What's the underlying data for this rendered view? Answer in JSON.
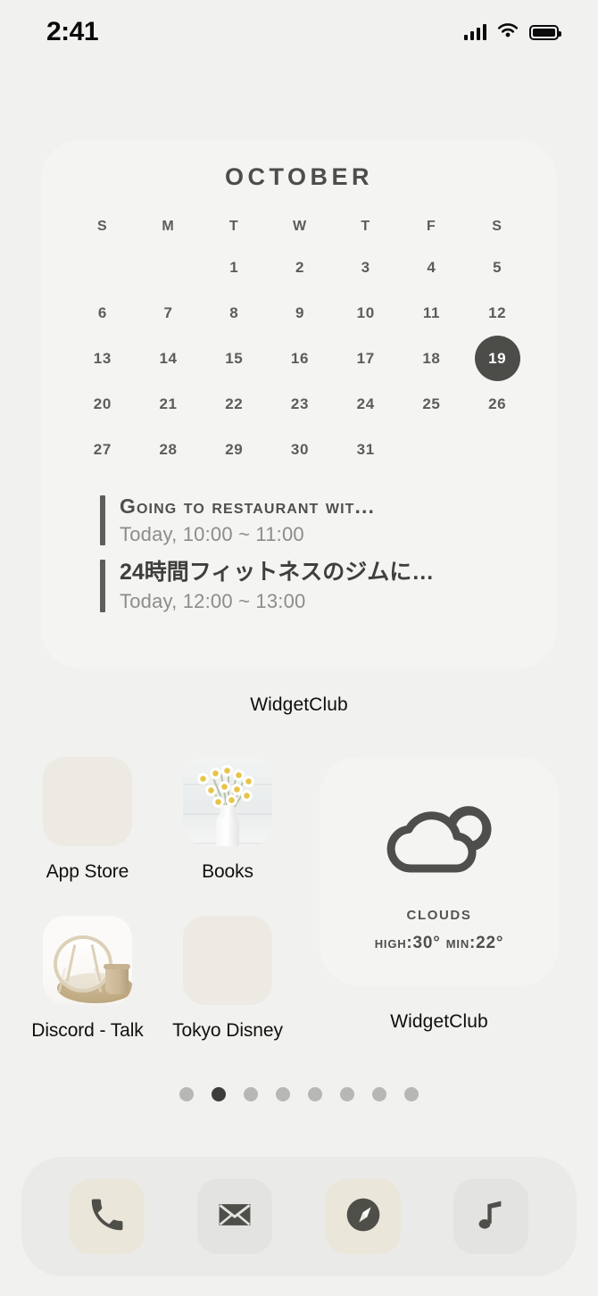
{
  "status_bar": {
    "time": "2:41",
    "signal_icon": "cellular-signal-icon",
    "wifi_icon": "wifi-icon",
    "battery_icon": "battery-full-icon"
  },
  "calendar_widget": {
    "month": "October",
    "weekdays": [
      "S",
      "M",
      "T",
      "W",
      "T",
      "F",
      "S"
    ],
    "weeks": [
      [
        "",
        "",
        "1",
        "2",
        "3",
        "4",
        "5"
      ],
      [
        "6",
        "7",
        "8",
        "9",
        "10",
        "11",
        "12"
      ],
      [
        "13",
        "14",
        "15",
        "16",
        "17",
        "18",
        "19"
      ],
      [
        "20",
        "21",
        "22",
        "23",
        "24",
        "25",
        "26"
      ],
      [
        "27",
        "28",
        "29",
        "30",
        "31",
        "",
        ""
      ]
    ],
    "today": "19",
    "accent_color": "#4c4c49",
    "events": [
      {
        "title": "Going to restaurant wit...",
        "time": "Today, 10:00 ~ 11:00"
      },
      {
        "title": "24時間フィットネスのジムに…",
        "time": "Today, 12:00 ~ 13:00"
      }
    ],
    "label": "WidgetClub"
  },
  "apps": [
    {
      "name": "App Store",
      "icon": "app-store-icon",
      "tile_color": "#e6e2d1"
    },
    {
      "name": "Books",
      "icon": "books-flowers-photo-icon",
      "tile_color": "#eceff0"
    },
    {
      "name": "Discord - Talk",
      "icon": "discord-rattan-chair-photo-icon",
      "tile_color": "#faf9f7"
    },
    {
      "name": "Tokyo Disney",
      "icon": "tokyo-disney-icon",
      "tile_color": "#e2e2df"
    }
  ],
  "weather_widget": {
    "icon": "clouds-icon",
    "condition": "Clouds",
    "temps": "High:30° Min:22°",
    "label": "WidgetClub"
  },
  "page_dots": {
    "count": 8,
    "active_index": 1
  },
  "dock": [
    {
      "name": "Phone",
      "icon": "phone-icon",
      "tile_style": "beige"
    },
    {
      "name": "Mail",
      "icon": "mail-envelope-icon",
      "tile_style": "gray"
    },
    {
      "name": "Safari",
      "icon": "safari-compass-icon",
      "tile_style": "beige"
    },
    {
      "name": "Music",
      "icon": "music-note-icon",
      "tile_style": "gray"
    }
  ]
}
